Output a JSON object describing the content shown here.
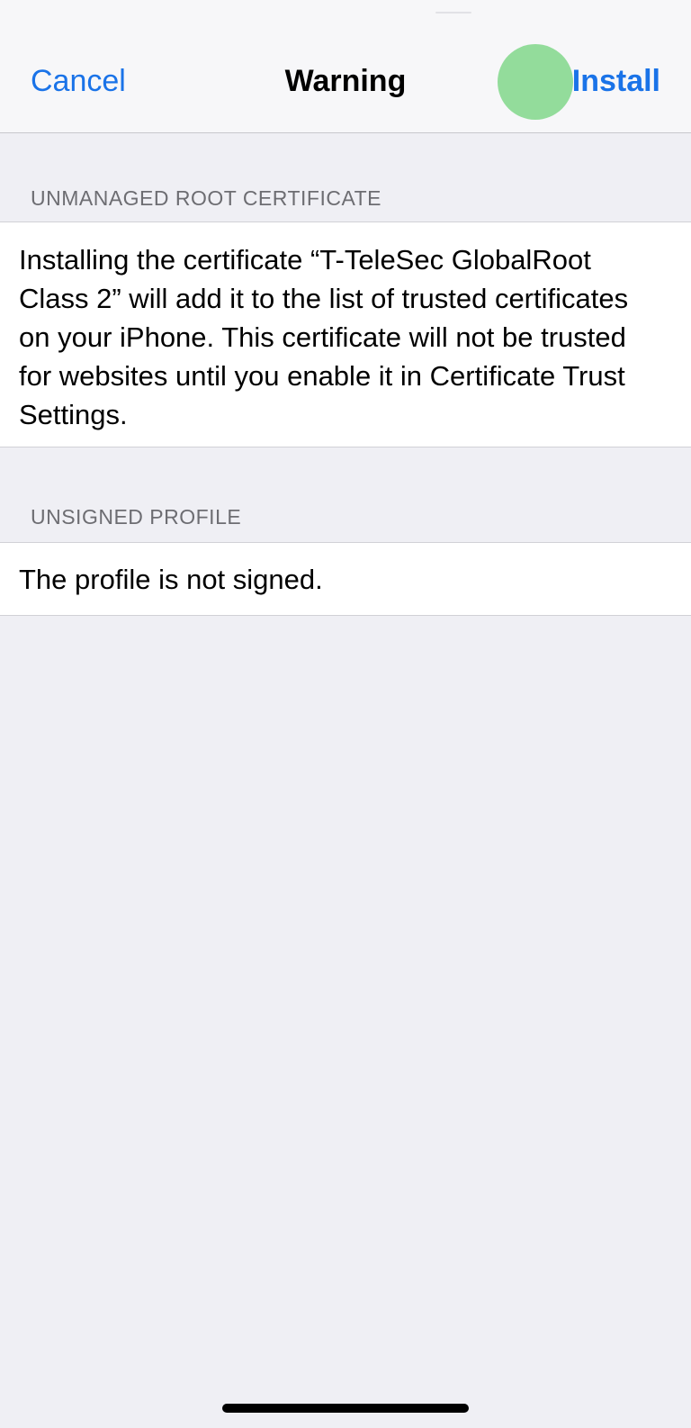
{
  "nav": {
    "cancel_label": "Cancel",
    "title": "Warning",
    "install_label": "Install"
  },
  "sections": [
    {
      "header": "UNMANAGED ROOT CERTIFICATE",
      "body": "Installing the certificate “T-TeleSec GlobalRoot Class 2” will add it to the list of trusted certificates on your iPhone. This certificate will not be trusted for websites until you enable it in Certificate Trust Settings."
    },
    {
      "header": "UNSIGNED PROFILE",
      "body": "The profile is not signed."
    }
  ],
  "colors": {
    "accent": "#1a73e8",
    "background": "#efeff4",
    "tap_indicator": "#93dc9b"
  }
}
